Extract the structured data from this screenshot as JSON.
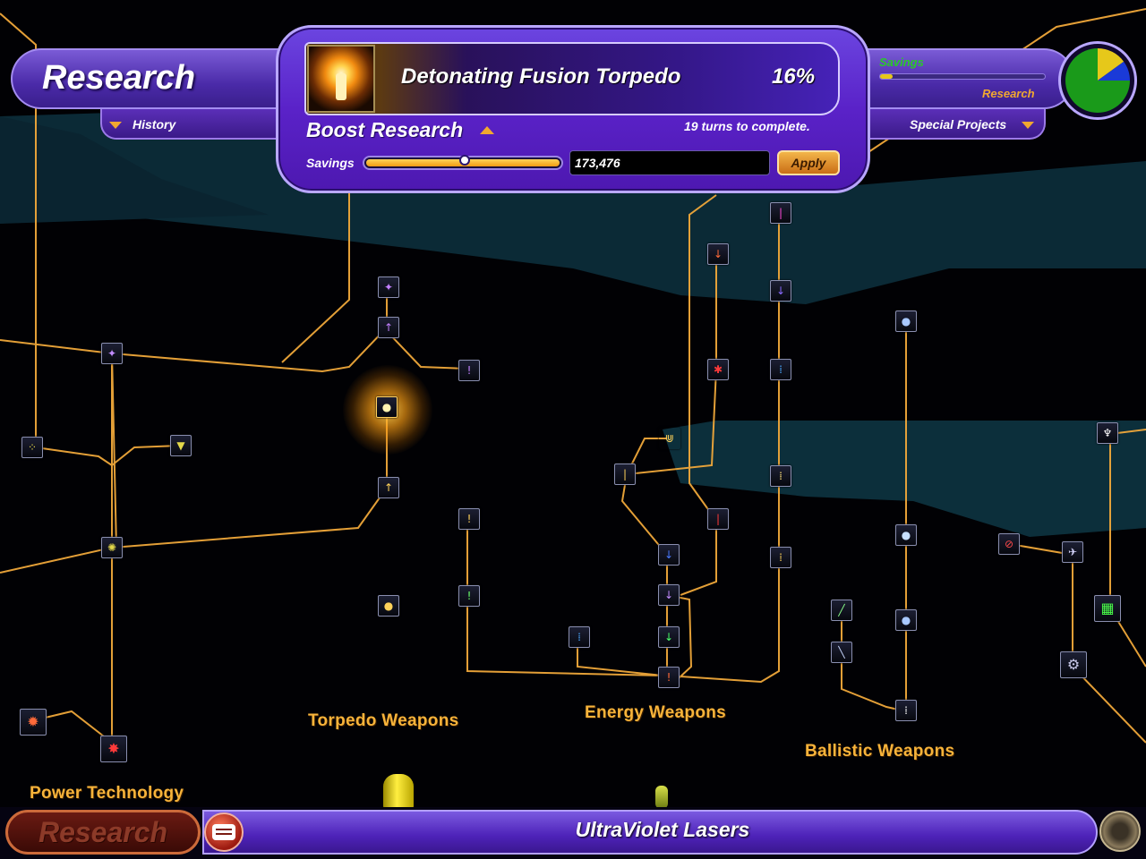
{
  "header": {
    "title": "Research",
    "history_label": "History",
    "special_projects_label": "Special Projects",
    "savings_mini_label": "Savings",
    "research_mini_label": "Research"
  },
  "current_research": {
    "name": "Detonating Fusion Torpedo",
    "progress": "16%",
    "progress_value": 16,
    "turns_text": "19 turns to complete."
  },
  "boost": {
    "label": "Boost Research",
    "savings_label": "Savings",
    "savings_value": "173,476",
    "slider_fraction": 0.49,
    "apply_label": "Apply"
  },
  "allocation_pie": {
    "green": 0.75,
    "blue": 0.1,
    "yellow": 0.15,
    "colors": {
      "green": "#1a9a1a",
      "blue": "#1a3ad8",
      "yellow": "#e6c81a"
    }
  },
  "groups": {
    "torpedo": "Torpedo Weapons",
    "energy": "Energy Weapons",
    "ballistic": "Ballistic Weapons",
    "power": "Power Technology"
  },
  "bottom_bar": {
    "research_button": "Research",
    "selected_tech": "UltraViolet Lasers"
  },
  "colors": {
    "accent_purple": "#5a22c8",
    "tree_line": "#f0a83a",
    "label_orange": "#f7b33a"
  }
}
